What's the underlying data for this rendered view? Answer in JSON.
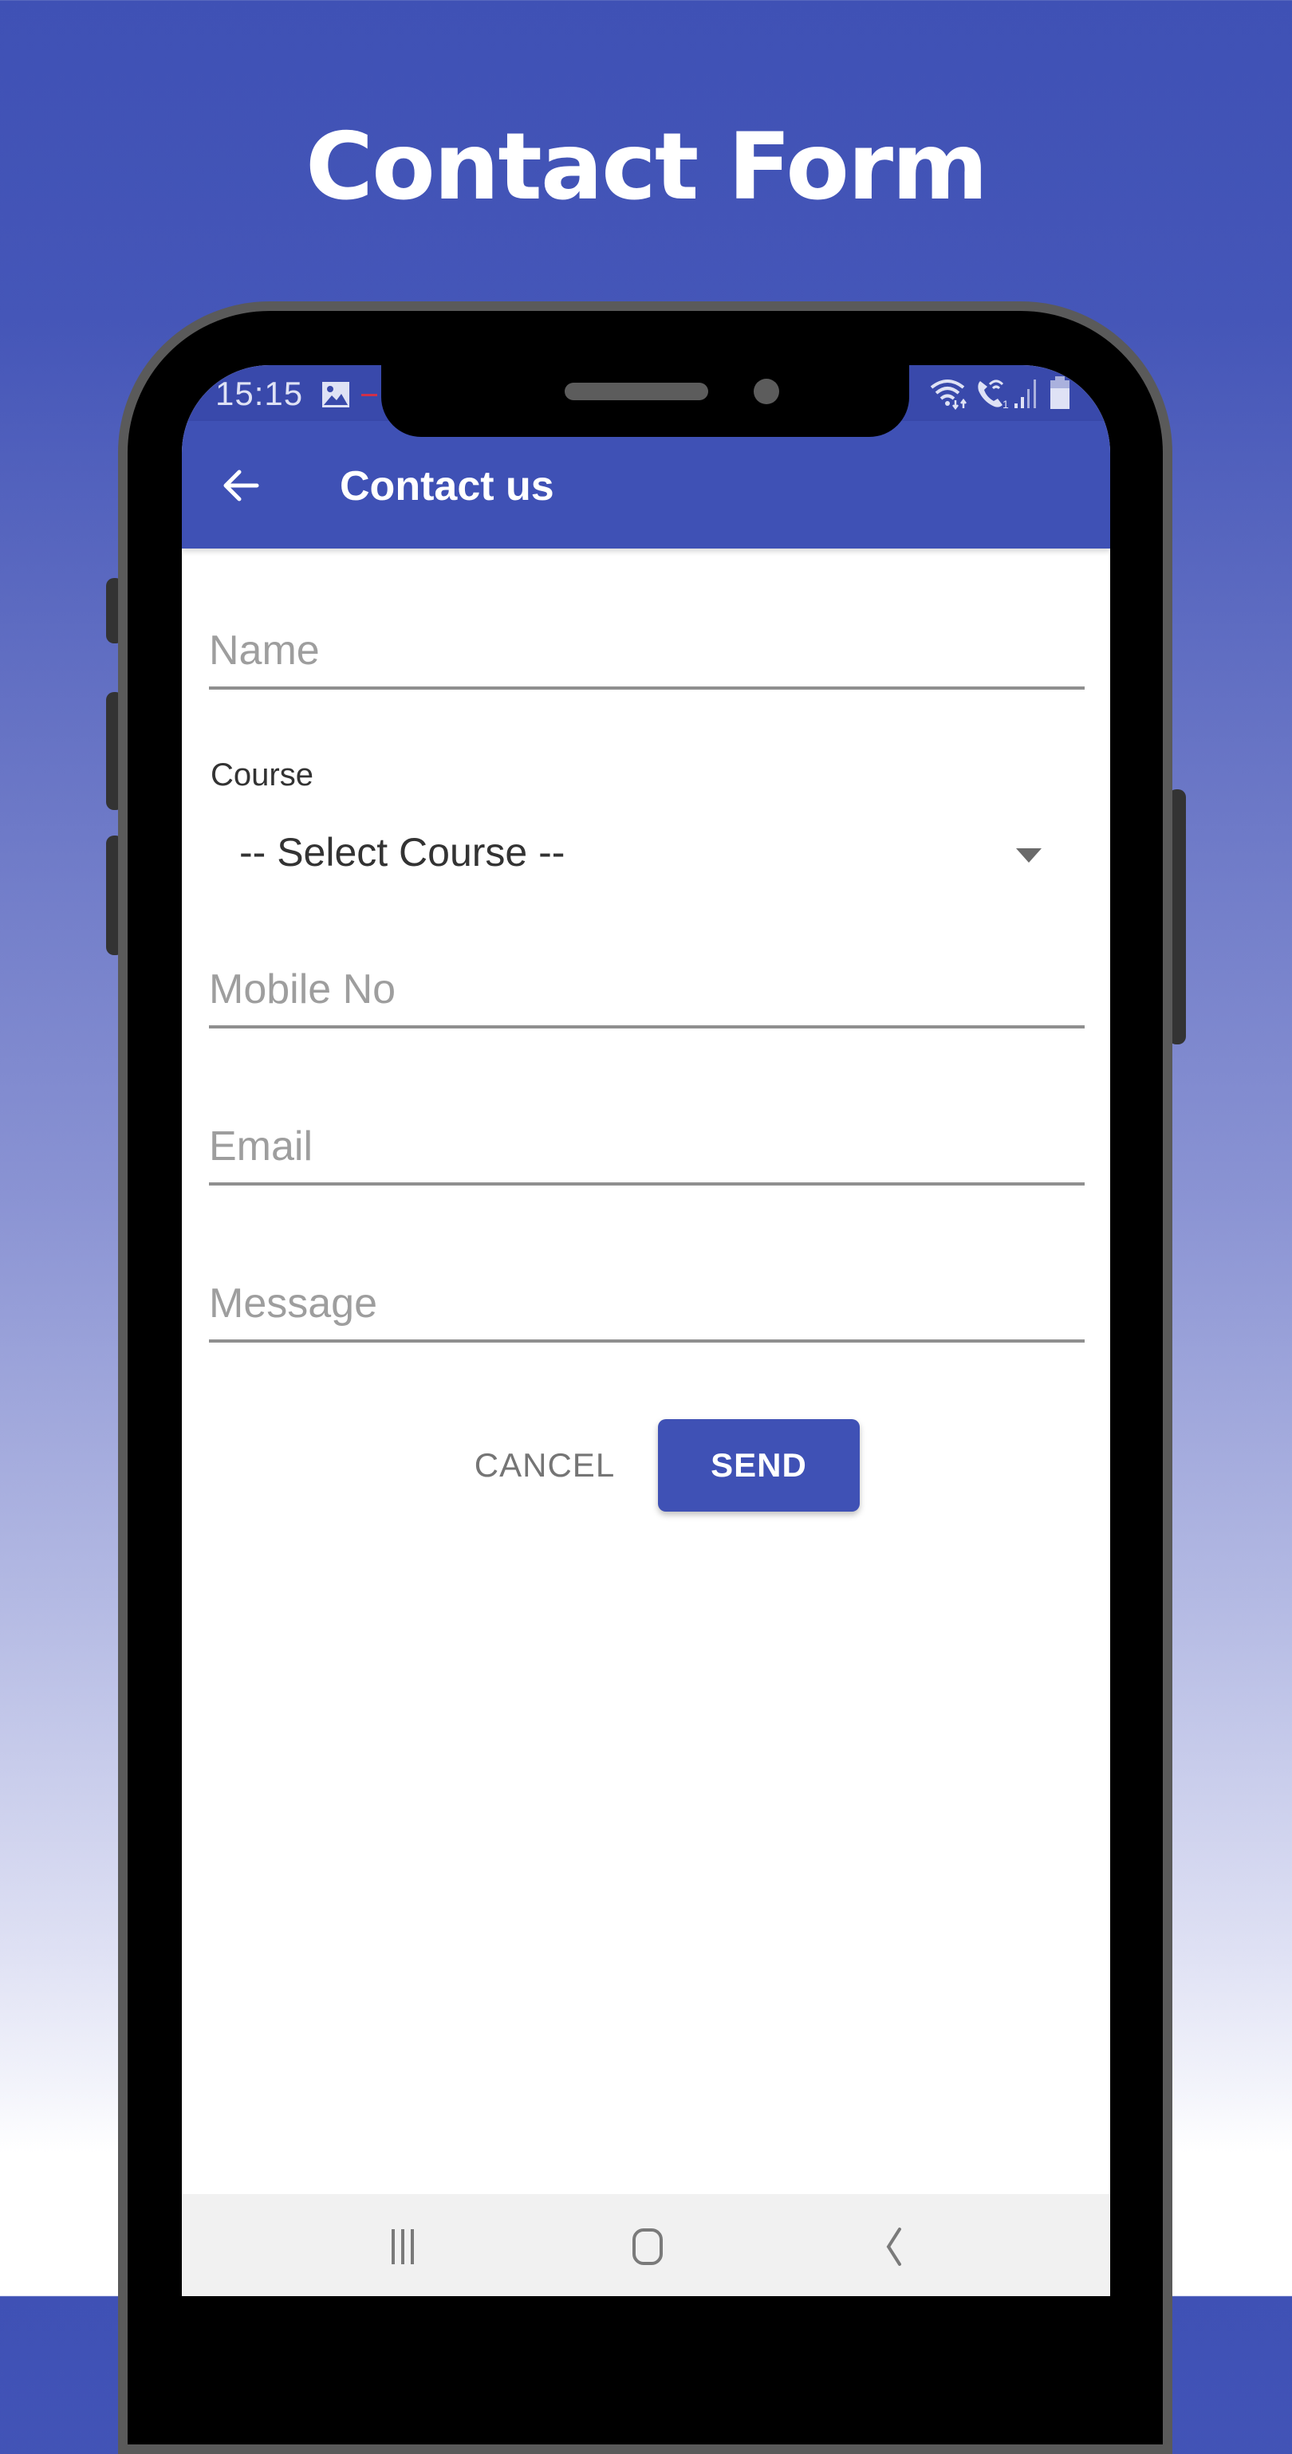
{
  "promo": {
    "title": "Contact Form"
  },
  "status_bar": {
    "time": "15:15",
    "icons": [
      "gallery-icon",
      "wifi-icon",
      "wifi-calling-icon",
      "signal-icon",
      "battery-icon"
    ]
  },
  "toolbar": {
    "back_icon": "arrow-left-icon",
    "title": "Contact us"
  },
  "form": {
    "name": {
      "placeholder": "Name",
      "value": ""
    },
    "course": {
      "label": "Course",
      "selected": "-- Select Course --"
    },
    "mobile": {
      "placeholder": "Mobile No",
      "value": ""
    },
    "email": {
      "placeholder": "Email",
      "value": ""
    },
    "message": {
      "placeholder": "Message",
      "value": ""
    },
    "cancel_label": "CANCEL",
    "send_label": "SEND"
  },
  "nav_bar": {
    "buttons": [
      "recent-apps-icon",
      "home-icon",
      "back-icon"
    ]
  },
  "colors": {
    "primary": "#3f51b5",
    "primary_dark": "#3949ab",
    "hint": "#9e9e9e",
    "text": "#333333"
  }
}
